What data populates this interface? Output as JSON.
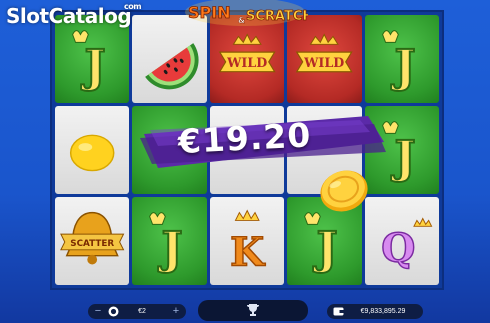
{
  "watermark": {
    "name": "SlotCatalog",
    "tld": "com"
  },
  "game": {
    "logo_text": "Spin & Scratch"
  },
  "grid": {
    "cells": [
      {
        "symbol": "J",
        "bg": "green"
      },
      {
        "symbol": "watermelon-icon",
        "bg": "white"
      },
      {
        "symbol": "WILD",
        "bg": "red"
      },
      {
        "symbol": "WILD",
        "bg": "red"
      },
      {
        "symbol": "J",
        "bg": "green"
      },
      {
        "symbol": "lemon-icon",
        "bg": "white"
      },
      {
        "symbol": "",
        "bg": "green"
      },
      {
        "symbol": "",
        "bg": "white"
      },
      {
        "symbol": "",
        "bg": "white"
      },
      {
        "symbol": "J",
        "bg": "green"
      },
      {
        "symbol": "SCATTER",
        "bg": "white"
      },
      {
        "symbol": "J",
        "bg": "green"
      },
      {
        "symbol": "K",
        "bg": "white"
      },
      {
        "symbol": "J",
        "bg": "green"
      },
      {
        "symbol": "Q",
        "bg": "white"
      }
    ]
  },
  "win": {
    "amount": "€19.20"
  },
  "controls": {
    "minus": "−",
    "plus": "+",
    "bet": "€2",
    "balance": "€9,833,895.29"
  },
  "colors": {
    "accent_green": "#2e9a2c",
    "wild_red": "#b42a25",
    "banner_purple": "#5b2aa8",
    "background_blue": "#1e5fd8"
  }
}
